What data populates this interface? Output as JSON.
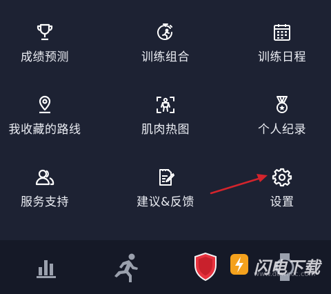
{
  "menu": {
    "items": [
      {
        "label": "成绩预测",
        "icon": "trophy-icon"
      },
      {
        "label": "训练组合",
        "icon": "timer-runner-icon"
      },
      {
        "label": "训练日程",
        "icon": "calendar-icon"
      },
      {
        "label": "我收藏的路线",
        "icon": "map-pin-icon"
      },
      {
        "label": "肌肉热图",
        "icon": "body-scan-icon"
      },
      {
        "label": "个人纪录",
        "icon": "medal-icon"
      },
      {
        "label": "服务支持",
        "icon": "users-icon"
      },
      {
        "label": "建议&反馈",
        "icon": "edit-note-icon"
      },
      {
        "label": "设置",
        "icon": "gear-icon"
      }
    ]
  },
  "tabbar": {
    "tabs": [
      {
        "icon": "stats-bar-icon"
      },
      {
        "icon": "running-man-icon"
      },
      {
        "icon": "shield-icon"
      },
      {
        "icon": "watch-icon"
      }
    ]
  },
  "watermark": {
    "text": "闪电下载",
    "url": "www.downcc.com"
  },
  "colors": {
    "background": "#1d2233",
    "tabbar": "#151927",
    "accent_red": "#e8333f",
    "text": "#eceef4"
  }
}
